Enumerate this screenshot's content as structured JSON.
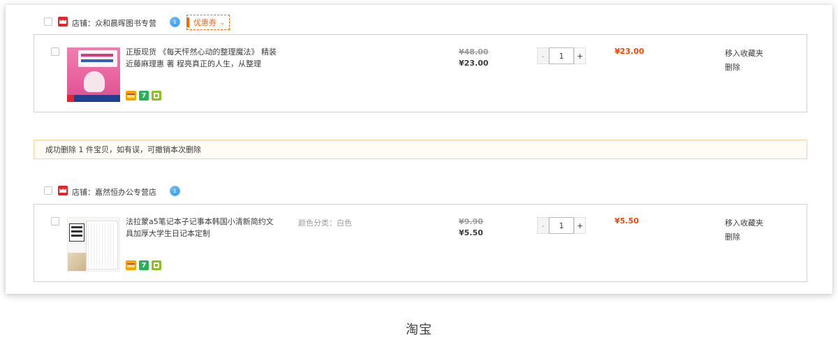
{
  "shops": [
    {
      "label": "店铺：众和晨晖图书专营",
      "wangwang_badge": "1",
      "coupon_label": "优惠券",
      "item": {
        "title": "正版现货 《每天怦然心动的整理魔法》 精装近藤麻理惠 著 程亮真正的人生，从整理",
        "sku": "",
        "price_old": "¥48.00",
        "price_now": "¥23.00",
        "quantity": "1",
        "subtotal": "¥23.00",
        "move_to_favorites": "移入收藏夹",
        "delete": "删除",
        "thumbnail": "book-cover"
      }
    },
    {
      "label": "店铺：嘉然恒办公专营店",
      "wangwang_badge": "1",
      "item": {
        "title": "法拉蒙a5笔记本子记事本韩国小清新简约文具加厚大学生日记本定制",
        "sku": "颜色分类：白色",
        "price_old": "¥9.90",
        "price_now": "¥5.50",
        "quantity": "1",
        "subtotal": "¥5.50",
        "move_to_favorites": "移入收藏夹",
        "delete": "删除",
        "thumbnail": "notebook"
      }
    }
  ],
  "notice": "成功删除 1 件宝贝，如有误，可撤销本次删除",
  "caption": "淘宝",
  "qty_controls": {
    "minus": "-",
    "plus": "+"
  },
  "colors": {
    "accent": "#ff4400",
    "coupon": "#ff6600",
    "shop_logo": "#e3242b",
    "notice_border": "#f5d3a0"
  }
}
